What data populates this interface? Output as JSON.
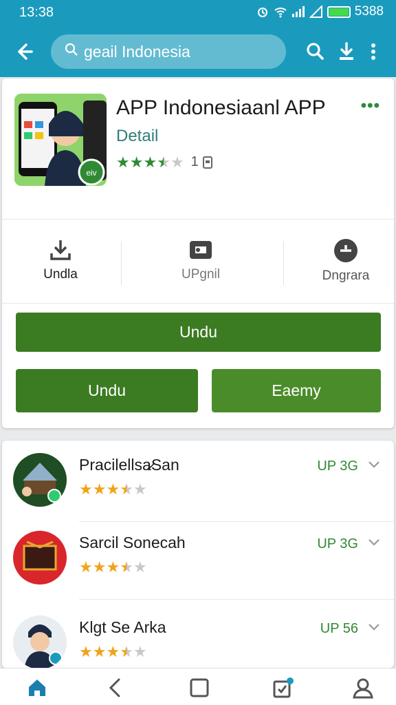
{
  "status_bar": {
    "time": "13:38",
    "battery_text": "5388"
  },
  "search": {
    "query": "gеail Indonesia"
  },
  "app": {
    "title": "APP Indonesiaanl APP",
    "subtitle": "Detail",
    "rating": 3.5,
    "rating_count": "1"
  },
  "actions": [
    {
      "label": "Undla",
      "icon": "download-icon"
    },
    {
      "label": "UPgnil",
      "icon": "gamepad-icon"
    },
    {
      "label": "Dngrara",
      "icon": "add-circle-icon"
    }
  ],
  "buttons": {
    "primary": "Undu",
    "secondary_left": "Undu",
    "secondary_right": "Eaemy"
  },
  "list": [
    {
      "name": "Pracilellsa̷San",
      "size": "UP 3G",
      "rating": 3.5
    },
    {
      "name": "Sarcil Soneсah",
      "size": "UP 3G",
      "rating": 3.5
    },
    {
      "name": "Klgt Se Arka",
      "size": "UP 56",
      "rating": 3.5
    }
  ],
  "colors": {
    "accent": "#1a9bbd",
    "button_green": "#3b7b22",
    "star_green": "#2f8a33",
    "star_orange": "#f0a31a"
  },
  "bottom_nav": [
    "home-icon",
    "back-icon",
    "square-icon",
    "notification-icon",
    "profile-icon"
  ]
}
